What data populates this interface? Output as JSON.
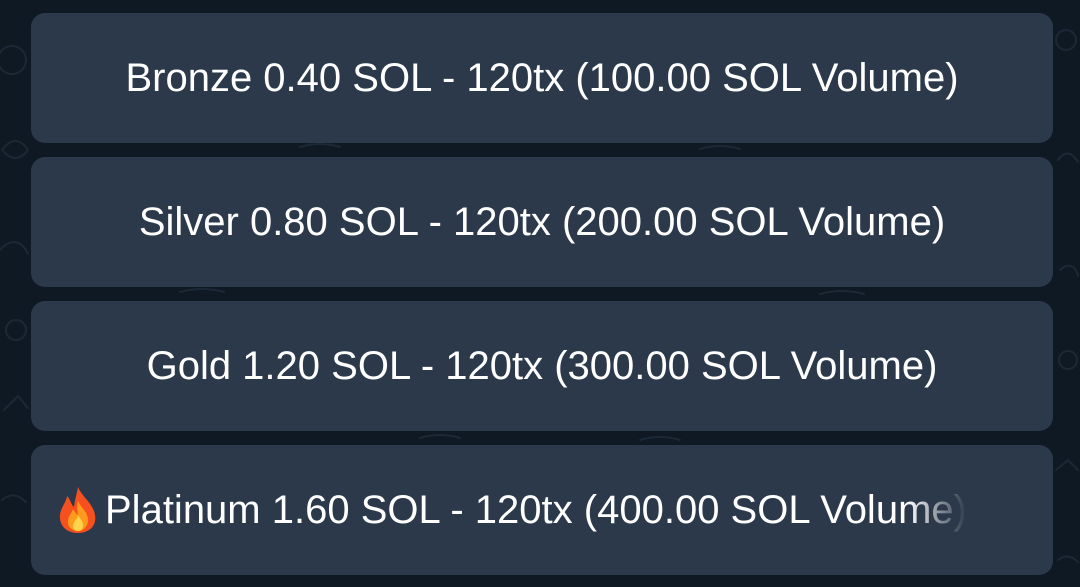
{
  "colors": {
    "background": "#0f1924",
    "button_bg": "#2b394b",
    "button_text": "#ffffff"
  },
  "keyboard": {
    "buttons": [
      {
        "label": "Bronze 0.40 SOL - 120tx (100.00 SOL Volume)"
      },
      {
        "label": "Silver 0.80 SOL - 120tx (200.00 SOL Volume)"
      },
      {
        "label": "Gold 1.20 SOL - 120tx (300.00 SOL Volume)"
      },
      {
        "icon": "fire-icon",
        "label": "Platinum 1.60 SOL - 120tx (400.00 SOL Volume)"
      }
    ]
  }
}
